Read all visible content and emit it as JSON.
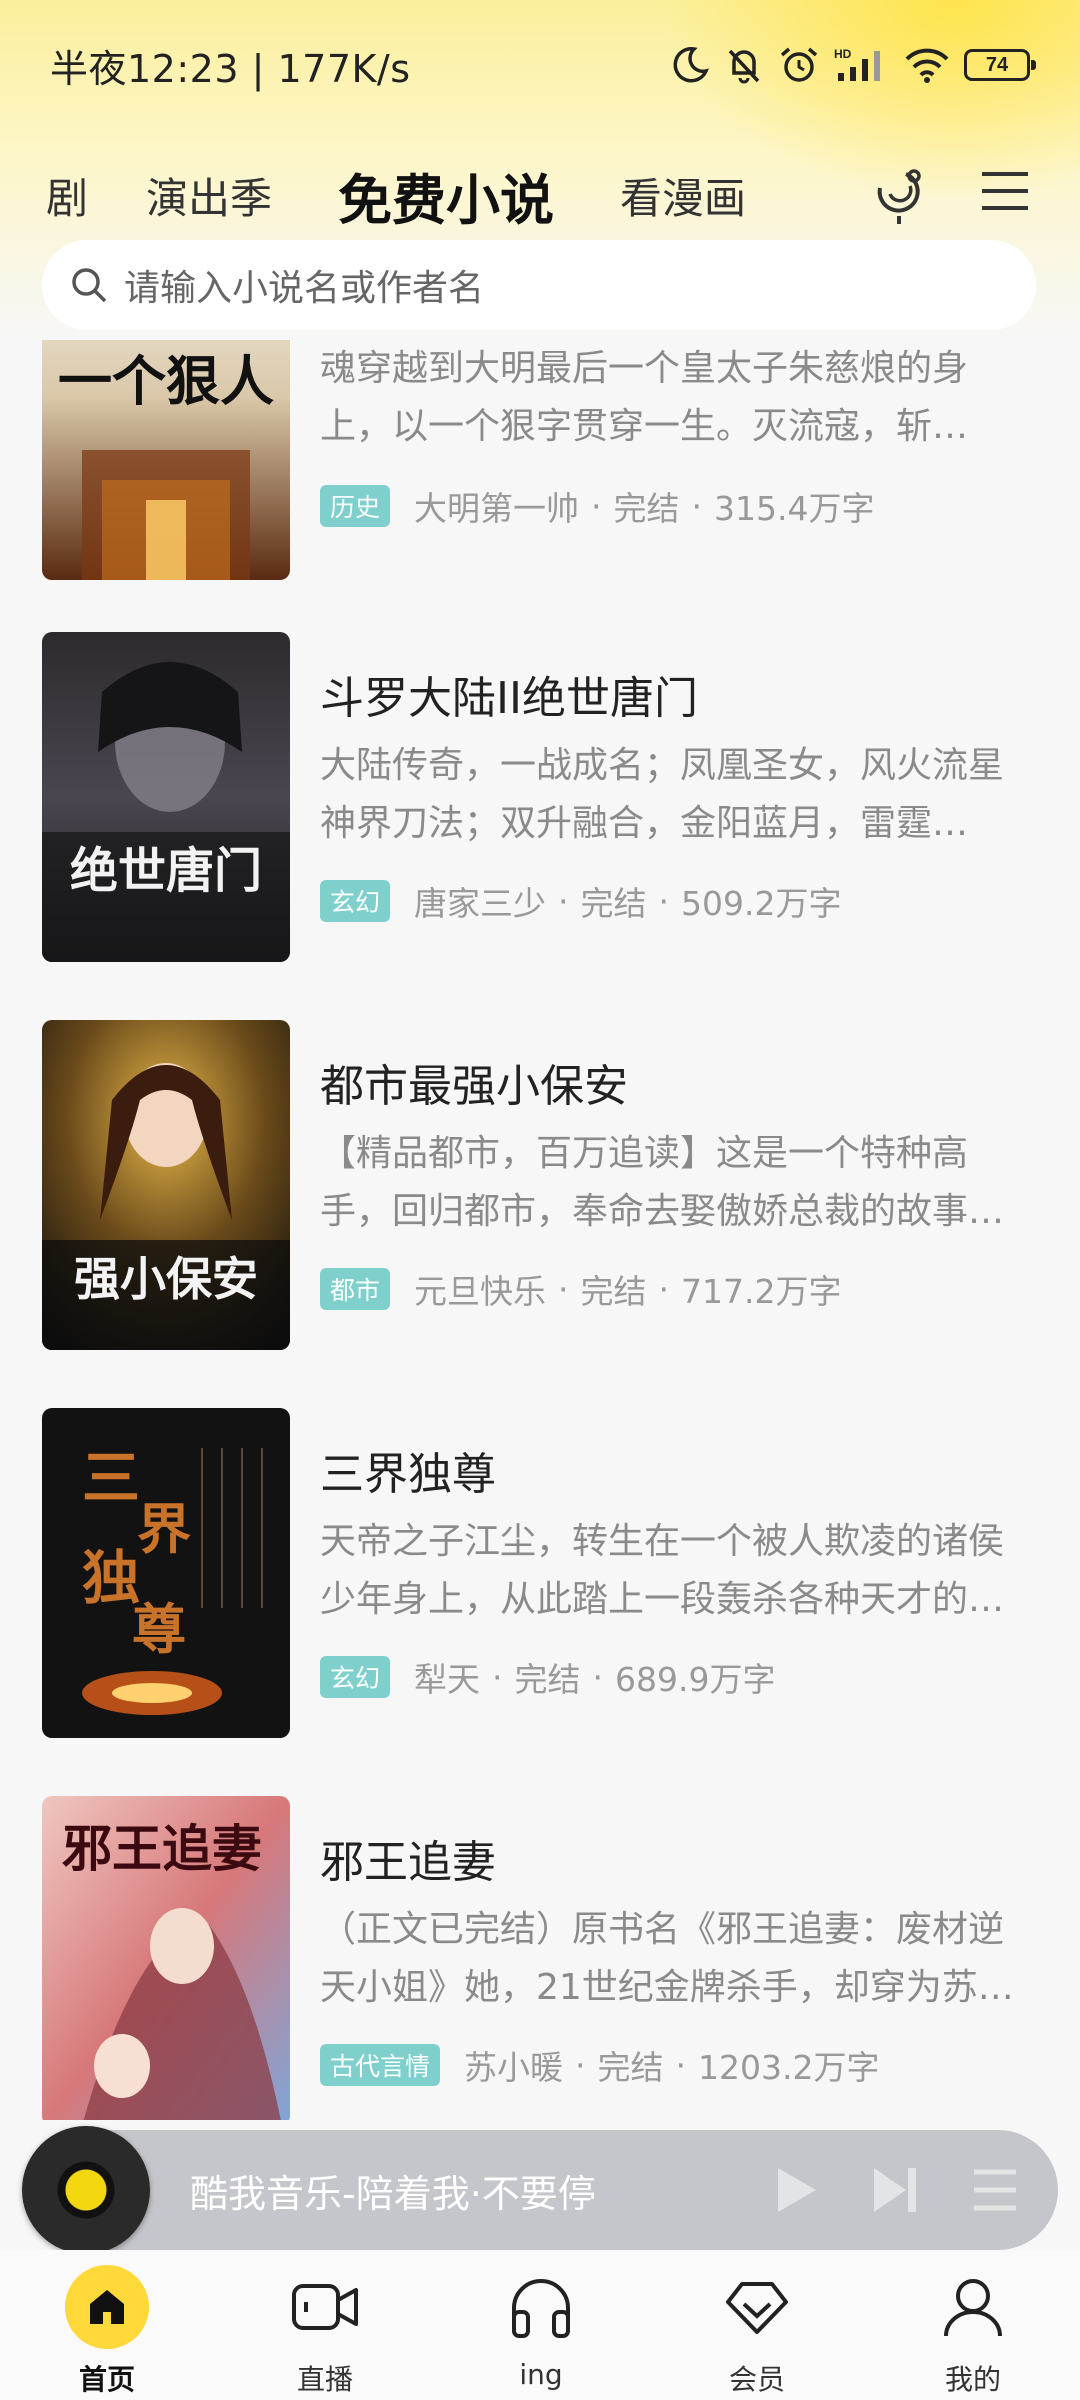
{
  "status": {
    "time": "半夜12:23 | 177K/s",
    "battery": "74",
    "icons": [
      "moon-icon",
      "bell-off-icon",
      "alarm-icon",
      "hd-signal-icon",
      "wifi-icon",
      "battery-icon"
    ]
  },
  "tabs": [
    {
      "label": "剧",
      "active": false
    },
    {
      "label": "演出季",
      "active": false
    },
    {
      "label": "免费小说",
      "active": true
    },
    {
      "label": "看漫画",
      "active": false
    }
  ],
  "header_icons": [
    "voice-assistant-icon",
    "menu-icon"
  ],
  "search": {
    "placeholder": "请输入小说名或作者名"
  },
  "books": [
    {
      "title": "",
      "cover_text": "一个狠人",
      "desc": "魂穿越到大明最后一个皇太子朱慈烺的身上，以一个狠字贯穿一生。灭流寇，斩…",
      "tag": "历史",
      "author": "大明第一帅",
      "status": "完结",
      "words": "315.4万字"
    },
    {
      "title": "斗罗大陆II绝世唐门",
      "cover_text": "绝世唐门",
      "desc": "大陆传奇，一战成名；凤凰圣女，风火流星神界刀法；双升融合，金阳蓝月，雷霆…",
      "tag": "玄幻",
      "author": "唐家三少",
      "status": "完结",
      "words": "509.2万字"
    },
    {
      "title": "都市最强小保安",
      "cover_text": "强小保安",
      "desc": "【精品都市，百万追读】这是一个特种高手，回归都市，奉命去娶傲娇总裁的故事…",
      "tag": "都市",
      "author": "元旦快乐",
      "status": "完结",
      "words": "717.2万字"
    },
    {
      "title": "三界独尊",
      "cover_text": "三界独尊",
      "desc": "天帝之子江尘，转生在一个被人欺凌的诸侯少年身上，从此踏上一段轰杀各种天才的…",
      "tag": "玄幻",
      "author": "犁天",
      "status": "完结",
      "words": "689.9万字"
    },
    {
      "title": "邪王追妻",
      "cover_text": "邪王追妻",
      "desc": "（正文已完结）原书名《邪王追妻：废材逆天小姐》她，21世纪金牌杀手，却穿为苏…",
      "tag": "古代言情",
      "author": "苏小暖",
      "status": "完结",
      "words": "1203.2万字"
    }
  ],
  "player": {
    "text": "酷我音乐-陪着我·不要停"
  },
  "nav": [
    {
      "label": "首页",
      "icon": "home-icon",
      "active": true
    },
    {
      "label": "直播",
      "icon": "live-camera-icon",
      "active": false
    },
    {
      "label": "ing",
      "icon": "headphones-icon",
      "active": false
    },
    {
      "label": "会员",
      "icon": "vip-diamond-icon",
      "active": false
    },
    {
      "label": "我的",
      "icon": "profile-icon",
      "active": false
    }
  ],
  "colors": {
    "accent_yellow": "#ffd83a",
    "tag_teal": "#7fd0cc",
    "header_gradient": "#fbef9c"
  }
}
